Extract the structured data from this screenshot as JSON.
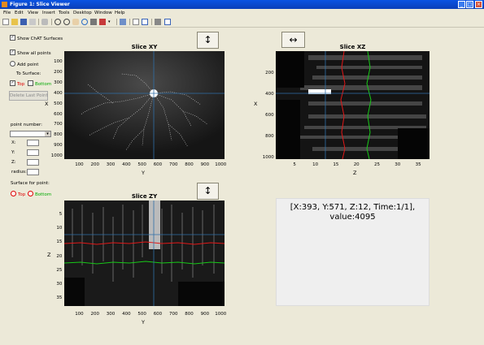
{
  "window": {
    "title": "Figure 1: Slice Viewer"
  },
  "menu": [
    "File",
    "Edit",
    "View",
    "Insert",
    "Tools",
    "Desktop",
    "Window",
    "Help"
  ],
  "controls": {
    "show_chat_surfaces": "Show ChAT Surfaces",
    "show_all_points": "Show all points",
    "add_point": "Add point",
    "to_surface": "To Surface:",
    "top": "Top",
    "bottom": "Bottom",
    "delete_last_point": "Delete Last Point",
    "point_number": "point number:",
    "x_label": "X:",
    "y_label": "Y:",
    "z_label": "Z:",
    "radius_label": "radius:",
    "surface_for_point": "Surface for point:",
    "radio_top": "Top",
    "radio_bottom": "Bottom"
  },
  "buttons": {
    "xy_arrow": "↕",
    "xz_arrow": "↔",
    "zy_arrow": "↕"
  },
  "panels": {
    "xy": {
      "title": "Slice XY",
      "xlabel": "Y",
      "ylabel": "X",
      "xticks": [
        "100",
        "200",
        "300",
        "400",
        "500",
        "600",
        "700",
        "800",
        "900",
        "1000"
      ],
      "yticks": [
        "100",
        "200",
        "300",
        "400",
        "500",
        "600",
        "700",
        "800",
        "900",
        "1000"
      ]
    },
    "xz": {
      "title": "Slice XZ",
      "xlabel": "Z",
      "ylabel": "X",
      "xticks": [
        "5",
        "10",
        "15",
        "20",
        "25",
        "30",
        "35"
      ],
      "yticks": [
        "200",
        "400",
        "600",
        "800",
        "1000"
      ]
    },
    "zy": {
      "title": "Slice ZY",
      "xlabel": "Y",
      "ylabel": "Z",
      "xticks": [
        "100",
        "200",
        "300",
        "400",
        "500",
        "600",
        "700",
        "800",
        "900",
        "1000"
      ],
      "yticks": [
        "5",
        "10",
        "15",
        "20",
        "25",
        "30",
        "35"
      ]
    }
  },
  "info": {
    "line1": "[X:393, Y:571, Z:12, Time:1/1],",
    "line2": "value:4095"
  },
  "colors": {
    "crosshair": "#2f6fa8",
    "top_surface": "#e01818",
    "bottom_surface": "#18c818",
    "titlebar": "#0a54e3"
  }
}
